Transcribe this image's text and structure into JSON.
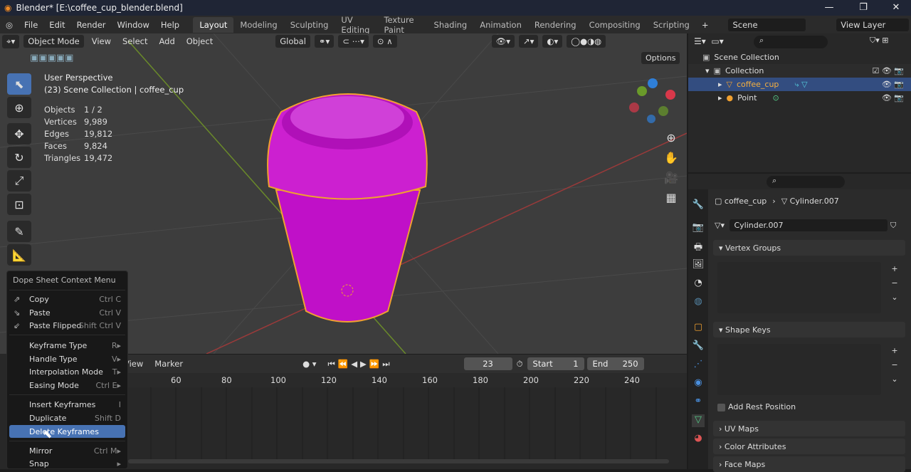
{
  "window": {
    "title": "Blender* [E:\\coffee_cup_blender.blend]",
    "controls": [
      "—",
      "❐",
      "✕"
    ]
  },
  "menubar": {
    "items": [
      "File",
      "Edit",
      "Render",
      "Window",
      "Help"
    ],
    "tabs": [
      "Layout",
      "Modeling",
      "Sculpting",
      "UV Editing",
      "Texture Paint",
      "Shading",
      "Animation",
      "Rendering",
      "Compositing",
      "Scripting"
    ],
    "active_tab": "Layout",
    "scene": "Scene",
    "view_layer": "View Layer"
  },
  "viewport": {
    "mode": "Object Mode",
    "menus": [
      "View",
      "Select",
      "Add",
      "Object"
    ],
    "orientation": "Global",
    "options": "Options",
    "perspective": "User Perspective",
    "context": "(23) Scene Collection | coffee_cup",
    "stats": [
      {
        "label": "Objects",
        "value": "1 / 2"
      },
      {
        "label": "Vertices",
        "value": "9,989"
      },
      {
        "label": "Edges",
        "value": "19,812"
      },
      {
        "label": "Faces",
        "value": "9,824"
      },
      {
        "label": "Triangles",
        "value": "19,472"
      }
    ],
    "colors": {
      "object": "#c415c8",
      "outline": "#f0a030"
    }
  },
  "timeline": {
    "menus": [
      "View",
      "Marker"
    ],
    "current_frame": "23",
    "start_label": "Start",
    "start": "1",
    "end_label": "End",
    "end": "250",
    "ticks": [
      "60",
      "80",
      "100",
      "120",
      "140",
      "160",
      "180",
      "200",
      "220",
      "240"
    ]
  },
  "context_menu": {
    "title": "Dope Sheet Context Menu",
    "items": [
      {
        "label": "Copy",
        "shortcut": "Ctrl C",
        "icon": "⇗"
      },
      {
        "label": "Paste",
        "shortcut": "Ctrl V",
        "icon": "⇘"
      },
      {
        "label": "Paste Flipped",
        "shortcut": "Shift Ctrl V",
        "icon": "⇙"
      },
      {
        "label": "Keyframe Type",
        "shortcut": "R▸"
      },
      {
        "label": "Handle Type",
        "shortcut": "V▸"
      },
      {
        "label": "Interpolation Mode",
        "shortcut": "T▸"
      },
      {
        "label": "Easing Mode",
        "shortcut": "Ctrl E▸"
      },
      {
        "label": "Insert Keyframes",
        "shortcut": "I"
      },
      {
        "label": "Duplicate",
        "shortcut": "Shift D"
      },
      {
        "label": "Delete Keyframes",
        "shortcut": ""
      },
      {
        "label": "Mirror",
        "shortcut": "Ctrl M▸"
      },
      {
        "label": "Snap",
        "shortcut": "▸"
      }
    ],
    "highlighted": "Delete Keyframes"
  },
  "outliner": {
    "rows": [
      "Scene Collection",
      "Collection",
      "coffee_cup",
      "Point"
    ]
  },
  "properties": {
    "object": "coffee_cup",
    "mesh": "Cylinder.007",
    "data_name": "Cylinder.007",
    "panels": [
      "Vertex Groups",
      "Shape Keys",
      "Add Rest Position",
      "UV Maps",
      "Color Attributes",
      "Face Maps"
    ]
  }
}
